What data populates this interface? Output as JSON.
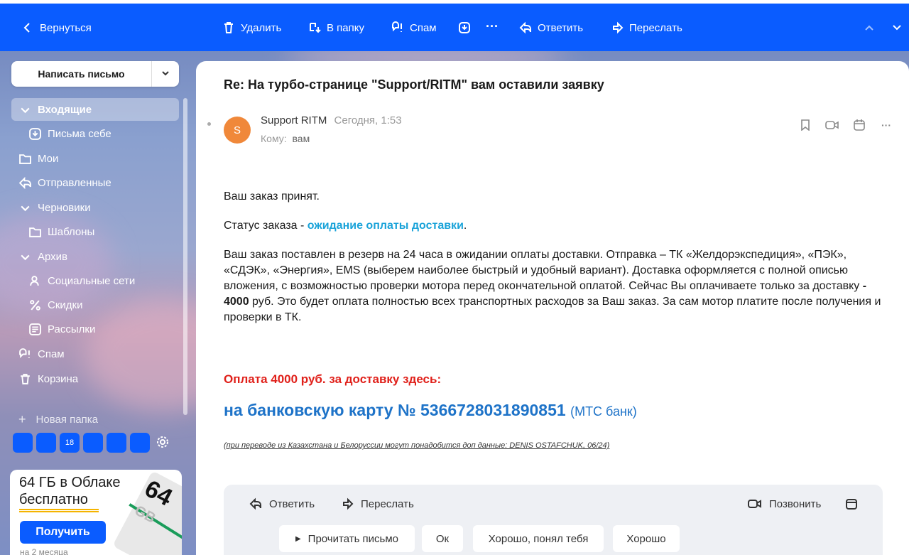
{
  "toolbar": {
    "back": "Вернуться",
    "delete": "Удалить",
    "to_folder": "В папку",
    "spam": "Спам",
    "reply": "Ответить",
    "forward": "Переслать"
  },
  "sidebar": {
    "compose": "Написать письмо",
    "folders": [
      {
        "label": "Входящие",
        "icon": "chevron-down-icon"
      },
      {
        "label": "Письма себе",
        "icon": "self-mail-icon"
      },
      {
        "label": "Мои",
        "icon": "folder-icon"
      },
      {
        "label": "Отправленные",
        "icon": "sent-icon"
      },
      {
        "label": "Черновики",
        "icon": "chevron-down-icon"
      },
      {
        "label": "Шаблоны",
        "icon": "folder-icon"
      },
      {
        "label": "Архив",
        "icon": "chevron-down-icon"
      },
      {
        "label": "Социальные сети",
        "icon": "people-icon"
      },
      {
        "label": "Скидки",
        "icon": "percent-icon"
      },
      {
        "label": "Рассылки",
        "icon": "newsletter-icon"
      },
      {
        "label": "Спам",
        "icon": "spam-icon"
      },
      {
        "label": "Корзина",
        "icon": "trash-icon"
      }
    ],
    "new_folder": "Новая папка",
    "labels": [
      "",
      "",
      "18",
      "",
      "",
      ""
    ],
    "promo": {
      "title_line1": "64 ГБ в Облаке",
      "title_line2": "бесплатно",
      "button": "Получить",
      "sub": "на 2 месяца",
      "badge_num": "64",
      "badge_unit": "GB"
    }
  },
  "message": {
    "subject": "Re: На турбо-странице \"Support/RITM\" вам оставили заявку",
    "avatar_letter": "S",
    "sender": "Support RITM",
    "time": "Сегодня, 1:53",
    "to_label": "Кому:",
    "to_value": "вам",
    "p1": "Ваш заказ принят.",
    "status_prefix": "Статус заказа - ",
    "status_value": "ожидание оплаты доставки",
    "status_suffix": ".",
    "p3a": "Ваш заказ поставлен в резерв на 24 часа в ожидании оплаты доставки. Отправка – ТК «Желдорэкспедиция», «ПЭК», «СДЭК», «Энергия», EMS (выберем наиболее быстрый и удобный вариант). Доставка оформляется с полной описью вложения, с возможностью проверки мотора перед окончательной оплатой. Сейчас Вы оплачиваете только за доставку ",
    "p3_amount": " - 4000",
    "p3b": " руб. Это будет оплата полностью всех транспортных расходов за Ваш заказ. За сам мотор платите после получения и проверки в ТК.",
    "pay_label": "Оплата 4000 руб. за доставку здесь:",
    "card_text": "на банковскую карту № 5366728031890851",
    "card_bank": "(МТС банк)",
    "note": "(при переводе из Казахстана и Белоруссии могут понадобится доп данные: DENIS OSTAFCHUK, 06/24)"
  },
  "reply_panel": {
    "reply": "Ответить",
    "forward": "Переслать",
    "call": "Позвонить",
    "quick": [
      "Прочитать письмо",
      "Ок",
      "Хорошо, понял тебя",
      "Хорошо"
    ]
  },
  "colors": {
    "accent": "#0a5cff",
    "status_link": "#1aa3d9",
    "pay_red": "#e0201a",
    "card_blue": "#1e73c8",
    "avatar": "#f0883a"
  }
}
